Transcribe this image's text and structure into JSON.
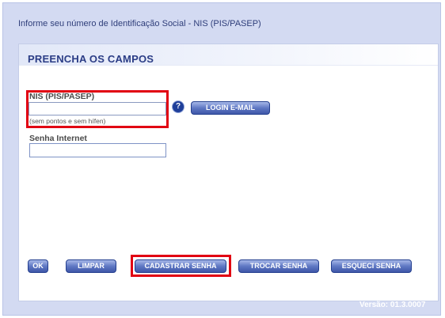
{
  "intro_text": "Informe seu número de Identificação Social - NIS (PIS/PASEP)",
  "panel": {
    "title": "PREENCHA OS CAMPOS"
  },
  "form": {
    "nis_label": "NIS (PIS/PASEP)",
    "nis_value": "",
    "nis_hint": "(sem pontos e sem hífen)",
    "help_glyph": "?",
    "login_email_label": "LOGIN E-MAIL",
    "senha_label": "Senha Internet",
    "senha_value": ""
  },
  "buttons": {
    "ok": "OK",
    "limpar": "LIMPAR",
    "cadastrar": "CADASTRAR SENHA",
    "trocar": "TROCAR SENHA",
    "esqueci": "ESQUECI SENHA"
  },
  "version_text": "Versão: 01.3.0007",
  "colors": {
    "background": "#d3daf2",
    "highlight": "#e10012",
    "button": "#4a63b4",
    "title": "#2b3d86"
  },
  "icons": {
    "help": "help-question-icon"
  }
}
